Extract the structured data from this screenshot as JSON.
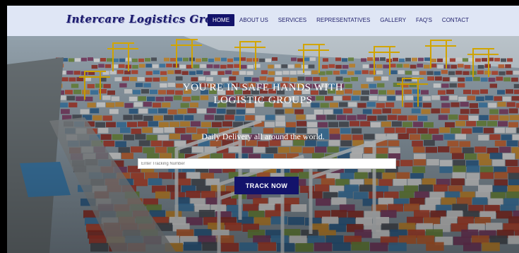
{
  "brand": {
    "logo_text": "Intercare Logistics Groups"
  },
  "nav": {
    "items": [
      {
        "label": "HOME",
        "active": true
      },
      {
        "label": "ABOUT US",
        "active": false
      },
      {
        "label": "SERVICES",
        "active": false
      },
      {
        "label": "REPRESENTATIVES",
        "active": false
      },
      {
        "label": "GALLERY",
        "active": false
      },
      {
        "label": "FAQ'S",
        "active": false
      },
      {
        "label": "CONTACT",
        "active": false
      }
    ]
  },
  "hero": {
    "headline_line1": "YOU'RE IN SAFE HANDS WITH",
    "headline_line2": "LOGISTIC GROUPS",
    "tagline": "Daily Delivery all around the world.",
    "tracking_placeholder": "Enter Tracking Number",
    "track_button": "TRACK NOW",
    "background_image": "container-port-aerial"
  },
  "colors": {
    "nav_bg": "#dfe6f5",
    "accent": "#13136b",
    "nav_text": "#1e1e6a"
  }
}
